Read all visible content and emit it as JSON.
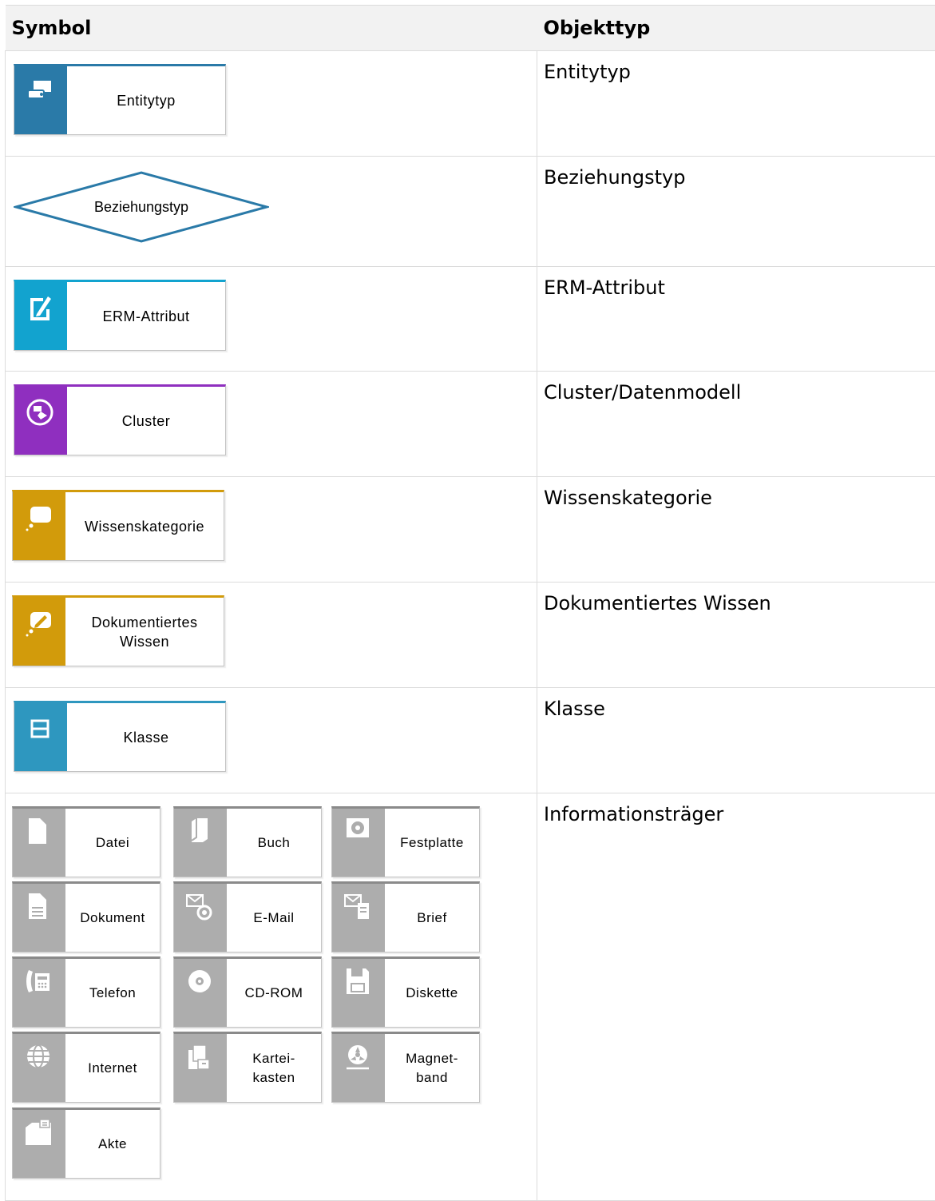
{
  "table": {
    "headers": {
      "symbol": "Symbol",
      "object_type": "Objekttyp"
    },
    "rows": [
      {
        "symbol_label": "Entitytyp",
        "object_type": "Entitytyp",
        "icon": "entity-type-icon",
        "color": "#2a7aa8"
      },
      {
        "symbol_label": "Beziehungstyp",
        "object_type": "Beziehungstyp",
        "icon": "diamond-shape",
        "color": "#2a7aa8"
      },
      {
        "symbol_label": "ERM-Attribut",
        "object_type": "ERM-Attribut",
        "icon": "edit-document-icon",
        "color": "#12a3cf"
      },
      {
        "symbol_label": "Cluster",
        "object_type": "Cluster/Datenmodell",
        "icon": "cluster-icon",
        "color": "#8f2fbf"
      },
      {
        "symbol_label": "Wissenskategorie",
        "object_type": "Wissenskategorie",
        "icon": "thought-bubble-icon",
        "color": "#d29b0b"
      },
      {
        "symbol_label": "Dokumentiertes\nWissen",
        "object_type": "Dokumentiertes Wissen",
        "icon": "thought-bubble-pencil-icon",
        "color": "#d29b0b"
      },
      {
        "symbol_label": "Klasse",
        "object_type": "Klasse",
        "icon": "class-icon",
        "color": "#2e97bf"
      },
      {
        "object_type": "Informationsträger",
        "carriers": [
          {
            "label": "Datei",
            "icon": "file-icon"
          },
          {
            "label": "Buch",
            "icon": "book-icon"
          },
          {
            "label": "Festplatte",
            "icon": "hard-disk-icon"
          },
          {
            "label": "Dokument",
            "icon": "document-icon"
          },
          {
            "label": "E-Mail",
            "icon": "email-icon"
          },
          {
            "label": "Brief",
            "icon": "letter-icon"
          },
          {
            "label": "Telefon",
            "icon": "phone-icon"
          },
          {
            "label": "CD-ROM",
            "icon": "cd-icon"
          },
          {
            "label": "Diskette",
            "icon": "floppy-icon"
          },
          {
            "label": "Internet",
            "icon": "globe-icon"
          },
          {
            "label": "Kartei-\nkasten",
            "icon": "card-box-icon"
          },
          {
            "label": "Magnet-\nband",
            "icon": "tape-icon"
          },
          {
            "label": "Akte",
            "icon": "folder-icon"
          }
        ],
        "carrier_color": "#adadad"
      }
    ]
  }
}
